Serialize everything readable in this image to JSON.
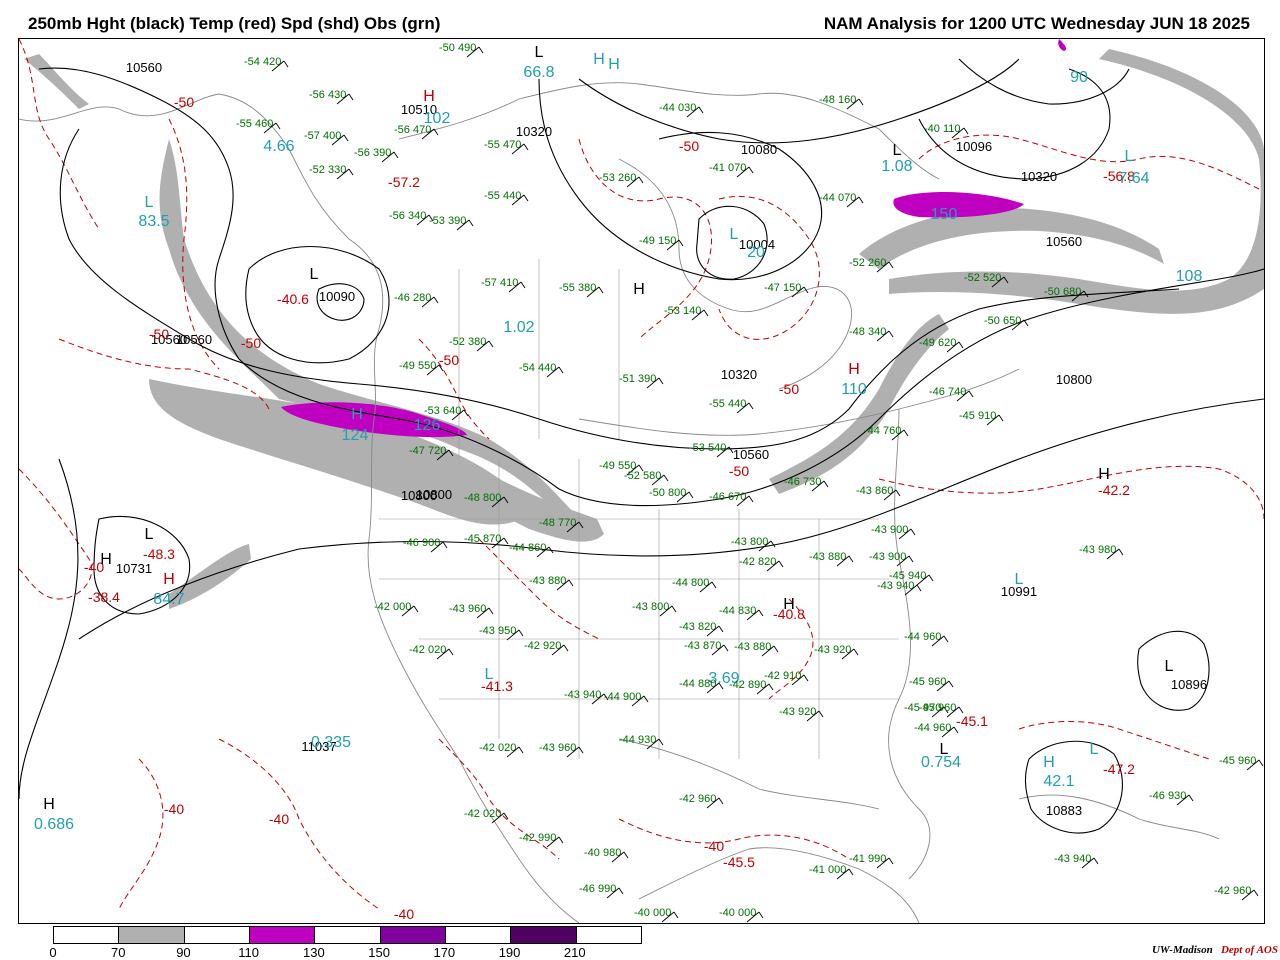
{
  "header": {
    "left_title": "250mb Hght (black) Temp (red) Spd (shd) Obs (grn)",
    "right_title": "NAM Analysis for 1200 UTC Wednesday  JUN 18 2025"
  },
  "colors": {
    "height": "#000000",
    "temp": "#c00000",
    "speed_label": "#20a0b0",
    "obs": "#007000",
    "shade_70": "#b0b0b0",
    "shade_110": "#c000c0",
    "shade_150": "#8000a0",
    "shade_190": "#500060"
  },
  "legend": {
    "ticks": [
      "0",
      "70",
      "90",
      "110",
      "130",
      "150",
      "170",
      "190",
      "210"
    ],
    "fills": [
      "#ffffff",
      "#b0b0b0",
      "#ffffff",
      "#c000c0",
      "#ffffff",
      "#8000a0",
      "#ffffff",
      "#500060",
      "#ffffff"
    ]
  },
  "credit": {
    "org": "UW-Madison",
    "dept": "Dept of AOS"
  },
  "map": {
    "height_labels": [
      "10560",
      "10510",
      "10560",
      "10320",
      "10080",
      "10096",
      "10320",
      "10560",
      "10090",
      "10560",
      "10800",
      "10560",
      "10800",
      "10320",
      "10004",
      "10731",
      "10800",
      "11037",
      "10991",
      "10896",
      "10883"
    ],
    "temp_labels": [
      "-50",
      "-57.2",
      "-40.6",
      "-50",
      "-50",
      "-50",
      "-50",
      "-50",
      "-50",
      "-48.3",
      "-40",
      "-38.4",
      "-41.3",
      "-42.2",
      "-40.8",
      "-45.1",
      "-47.2",
      "-45.5",
      "-40",
      "-40",
      "-40",
      "-40",
      "-56.8"
    ],
    "speed_labels": [
      "66.8",
      "4.66",
      "83.5",
      "102",
      "1.02",
      "1.08",
      "20",
      "150",
      "108",
      "90",
      "110",
      "124",
      "126",
      "84.7",
      "3.69",
      "0.335",
      "0.754",
      "42.1",
      "0.686",
      "7.64"
    ],
    "hl_labels": [
      "H",
      "L",
      "H",
      "L",
      "L",
      "H",
      "L",
      "L",
      "L",
      "H",
      "H",
      "L",
      "H",
      "H",
      "L",
      "L",
      "H",
      "H",
      "L",
      "H",
      "H",
      "L",
      "L",
      "H"
    ],
    "obs": [
      "-54 420",
      "-50 490",
      "-56 430",
      "-55 460",
      "-57 400",
      "-56 390",
      "-52 330",
      "-56 470",
      "-55 470",
      "-55 440",
      "-53 260",
      "-49 150",
      "-44 030",
      "-41 070",
      "-48 160",
      "-40 110",
      "-44 070",
      "-52 260",
      "-56 340",
      "-53 390",
      "-46 280",
      "-57 410",
      "-55 380",
      "-53 140",
      "-47 150",
      "-52 520",
      "-50 680",
      "-52 380",
      "-49 550",
      "-54 440",
      "-51 390",
      "-55 440",
      "-50 650",
      "-48 340",
      "-49 620",
      "-46 740",
      "-45 910",
      "-53 640",
      "-47 720",
      "-49 550",
      "-52 580",
      "-53 540",
      "-46 730",
      "-44 760",
      "-43 860",
      "-43 900",
      "-48 800",
      "-50 800",
      "-48 770",
      "-46 670",
      "-46 900",
      "-45 870",
      "-44 860",
      "-43 880",
      "-43 800",
      "-42 820",
      "-43 880",
      "-43 900",
      "-45 940",
      "-43 980",
      "-43 940",
      "-42 000",
      "-43 960",
      "-43 950",
      "-42 920",
      "-43 800",
      "-44 800",
      "-44 830",
      "-43 820",
      "-43 870",
      "-43 880",
      "-42 910",
      "-43 920",
      "-44 960",
      "-45 970",
      "-42 020",
      "-43 940",
      "-44 900",
      "-44 880",
      "-42 890",
      "-43 920",
      "-45 960",
      "-44 960",
      "-42 020",
      "-43 960",
      "-44 930",
      "-42 960",
      "-42 020",
      "-42 990",
      "-40 980",
      "-41 000",
      "-41 990",
      "-46 990",
      "-40 000",
      "-40 000",
      "-45 960",
      "-46 930",
      "-43 940",
      "-42 960",
      "-45 960"
    ]
  }
}
